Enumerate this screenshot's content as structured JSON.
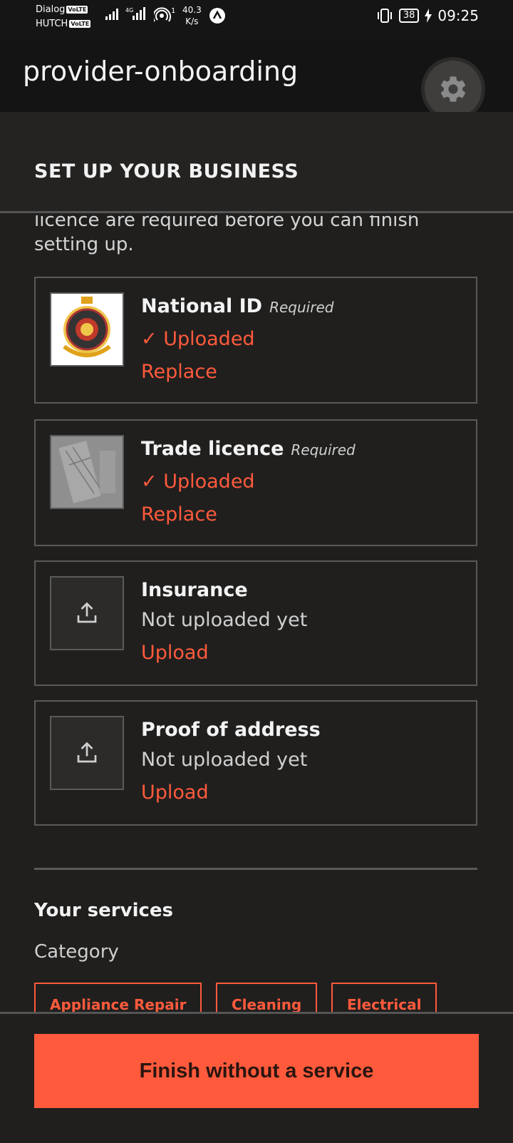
{
  "statusbar": {
    "carrier1": "Dialog",
    "carrier2": "HUTCH",
    "volte": "VoLTE",
    "network": "4G",
    "hotspot_count": "1",
    "speed_value": "40.3",
    "speed_unit": "K/s",
    "battery": "38",
    "time": "09:25"
  },
  "appbar": {
    "title": "provider-onboarding",
    "settings_icon": "gear-icon"
  },
  "section": {
    "title": "SET UP YOUR BUSINESS",
    "intro": "licence are required before you can finish setting up."
  },
  "documents": [
    {
      "name": "National ID",
      "tag": "Required",
      "status": "Uploaded",
      "action": "Replace",
      "uploaded": true
    },
    {
      "name": "Trade licence",
      "tag": "Required",
      "status": "Uploaded",
      "action": "Replace",
      "uploaded": true
    },
    {
      "name": "Insurance",
      "status": "Not uploaded yet",
      "action": "Upload",
      "uploaded": false
    },
    {
      "name": "Proof of address",
      "status": "Not uploaded yet",
      "action": "Upload",
      "uploaded": false
    }
  ],
  "services": {
    "title": "Your services",
    "category_label": "Category",
    "chips": [
      "Appliance Repair",
      "Cleaning",
      "Electrical"
    ]
  },
  "footer": {
    "finish_label": "Finish without a service"
  },
  "colors": {
    "accent": "#ff5a3c",
    "background": "#201f1e",
    "appbar": "#141414"
  }
}
